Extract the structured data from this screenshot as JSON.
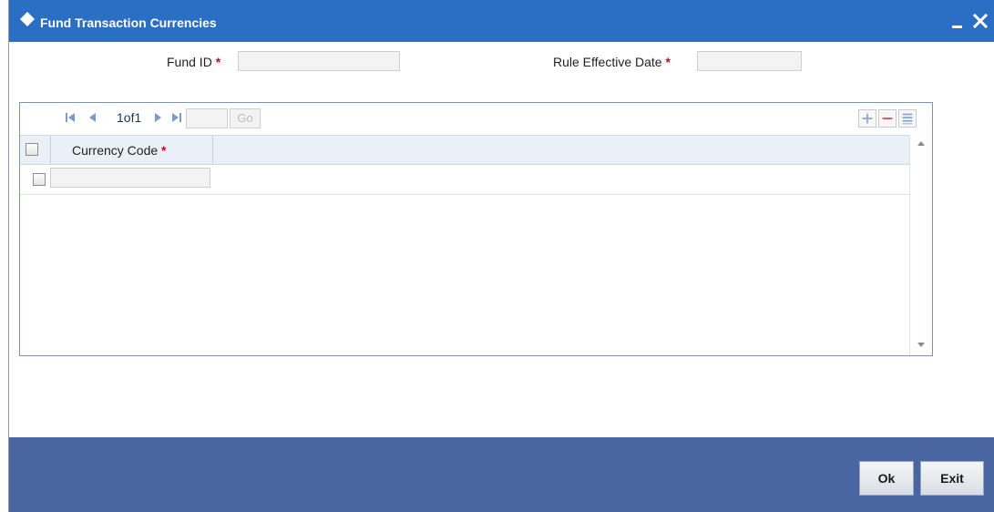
{
  "window": {
    "title": "Fund Transaction Currencies"
  },
  "form": {
    "fund_id_label": "Fund ID",
    "rule_effective_date_label": "Rule Effective Date",
    "required_marker": "*"
  },
  "grid": {
    "pager_text": "1of1",
    "go_label": "Go",
    "columns": [
      {
        "label": "Currency Code",
        "required": true
      }
    ],
    "rows": [
      {
        "currency_code": ""
      }
    ]
  },
  "footer": {
    "ok_label": "Ok",
    "exit_label": "Exit"
  },
  "colors": {
    "titlebar": "#2a6fc3",
    "footer": "#4a66a0",
    "required": "#d0021b"
  }
}
